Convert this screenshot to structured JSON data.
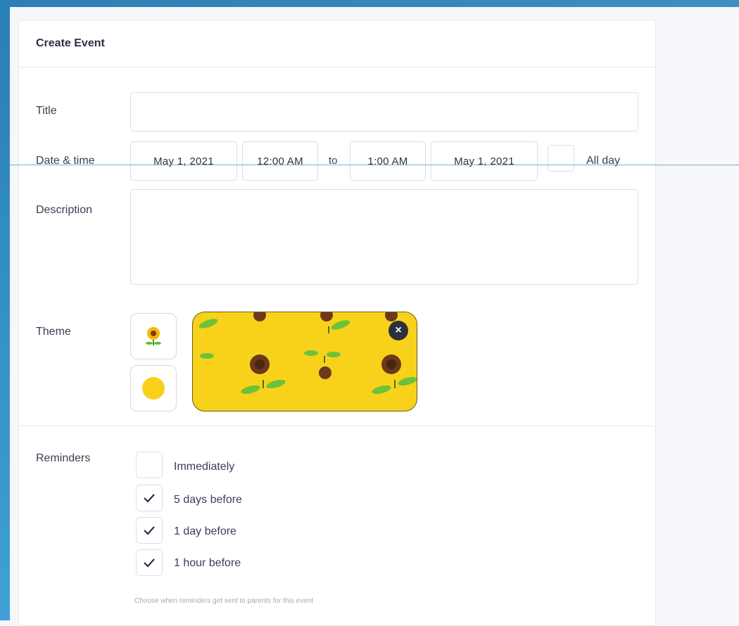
{
  "form": {
    "title": "Create Event",
    "fields": {
      "title_label": "Title",
      "title_value": "",
      "date_time_label": "Date & time",
      "start_date": "May 1, 2021",
      "start_time": "12:00 AM",
      "to_text": "to",
      "end_time": "1:00 AM",
      "end_date": "May 1, 2021",
      "all_day_label": "All day",
      "all_day_checked": false,
      "description_label": "Description",
      "description_value": "",
      "theme_label": "Theme"
    },
    "theme": {
      "accent": "#f8d21a",
      "icons": [
        "sunflower-icon",
        "yellow-dot-icon"
      ],
      "close_symbol": "×"
    },
    "reminders": {
      "label": "Reminders",
      "options": [
        {
          "label": "Immediately",
          "checked": false
        },
        {
          "label": "5 days before",
          "checked": true
        },
        {
          "label": "1 day before",
          "checked": true
        },
        {
          "label": "1 hour before",
          "checked": true
        }
      ],
      "hint": "Choose when reminders get sent to parents for this event"
    }
  }
}
